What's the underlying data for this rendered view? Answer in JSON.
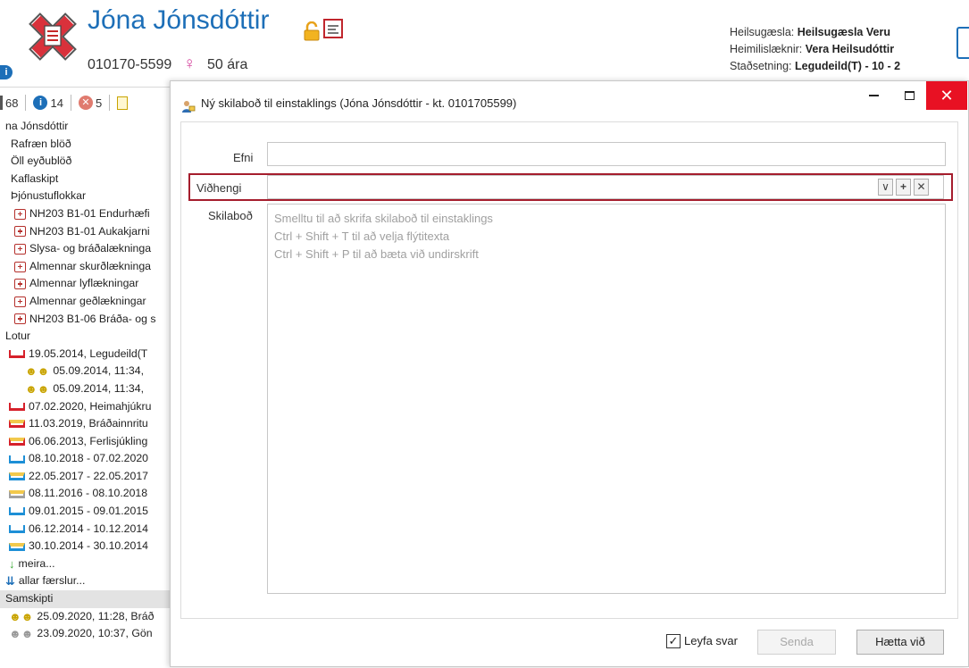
{
  "header": {
    "patient_name": "Jóna Jónsdóttir",
    "kennitala": "010170-5599",
    "age": "50 ára",
    "info_badge": "i",
    "clinic_label": "Heilsugæsla:",
    "clinic_value": "Heilsugæsla Veru",
    "doctor_label": "Heimilislæknir:",
    "doctor_value": "Vera Heilsudóttir",
    "location_label": "Staðsetning:",
    "location_value": "Legudeild(T) - 10 - 2"
  },
  "toolbar": {
    "count_1": "68",
    "count_info": "14",
    "info_glyph": "i",
    "count_alert": "5",
    "alert_glyph": "✕"
  },
  "tree": [
    {
      "label": "na Jónsdóttir",
      "icon": "none",
      "indent": 6
    },
    {
      "label": "Rafræn blöð",
      "icon": "none",
      "indent": 12
    },
    {
      "label": "Öll eyðublöð",
      "icon": "none",
      "indent": 12
    },
    {
      "label": "Kaflaskipt",
      "icon": "none",
      "indent": 12
    },
    {
      "label": "Þjónustuflokkar",
      "icon": "none",
      "indent": 12
    },
    {
      "label": "NH203 B1-01 Endurhæfi",
      "icon": "med",
      "indent": 16
    },
    {
      "label": "NH203 B1-01 Aukakjarni",
      "icon": "med",
      "indent": 16
    },
    {
      "label": "Slysa- og bráðalækninga",
      "icon": "med",
      "indent": 16
    },
    {
      "label": "Almennar skurðlækninga",
      "icon": "med",
      "indent": 16
    },
    {
      "label": "Almennar lyflækningar",
      "icon": "med",
      "indent": 16
    },
    {
      "label": "Almennar geðlækningar",
      "icon": "med",
      "indent": 16
    },
    {
      "label": "NH203 B1-06 Bráða- og s",
      "icon": "med",
      "indent": 16
    },
    {
      "label": "Lotur",
      "icon": "none",
      "indent": 6
    },
    {
      "label": "19.05.2014, Legudeild(T",
      "icon": "bed-red",
      "indent": 10
    },
    {
      "label": "05.09.2014, 11:34,",
      "icon": "people",
      "indent": 28
    },
    {
      "label": "05.09.2014, 11:34,",
      "icon": "people",
      "indent": 28
    },
    {
      "label": "07.02.2020, Heimahjúkru",
      "icon": "bed-red",
      "indent": 10
    },
    {
      "label": "11.03.2019, Bráðainnritu",
      "icon": "bed-redy",
      "indent": 10
    },
    {
      "label": "06.06.2013, Ferlisjúkling",
      "icon": "bed-redy",
      "indent": 10
    },
    {
      "label": "08.10.2018 - 07.02.2020",
      "icon": "bed-blue",
      "indent": 10
    },
    {
      "label": "22.05.2017 - 22.05.2017",
      "icon": "bed-bluey",
      "indent": 10
    },
    {
      "label": "08.11.2016 - 08.10.2018",
      "icon": "bed-grey",
      "indent": 10
    },
    {
      "label": "09.01.2015 - 09.01.2015",
      "icon": "bed-blue",
      "indent": 10
    },
    {
      "label": "06.12.2014 - 10.12.2014",
      "icon": "bed-blue",
      "indent": 10
    },
    {
      "label": "30.10.2014 - 30.10.2014",
      "icon": "bed-bluey",
      "indent": 10
    },
    {
      "label": "meira...",
      "icon": "arrow",
      "indent": 10
    },
    {
      "label": "allar færslur...",
      "icon": "darrow",
      "indent": 6
    },
    {
      "label": "Samskipti",
      "icon": "none",
      "indent": 6,
      "selected": true
    },
    {
      "label": "25.09.2020, 11:28, Bráð",
      "icon": "people",
      "indent": 10
    },
    {
      "label": "23.09.2020, 10:37, Gön",
      "icon": "people-grey",
      "indent": 10
    }
  ],
  "dialog": {
    "title": "Ný skilaboð til einstaklings (Jóna Jónsdóttir - kt. 0101705599)",
    "close_glyph": "✕",
    "efni_label": "Efni",
    "efni_value": "",
    "vidhengi_label": "Viðhengi",
    "vidhengi_value": "",
    "dropdown_glyph": "∨",
    "add_glyph": "+",
    "remove_glyph": "✕",
    "skilabod_label": "Skilaboð",
    "placeholder_lines": [
      "Smelltu til að skrifa skilaboð til einstaklings",
      "Ctrl + Shift + T til að velja flýtitexta",
      "Ctrl + Shift + P til að bæta við undirskrift"
    ],
    "allow_reply_label": "Leyfa svar",
    "allow_reply_checked": true,
    "check_glyph": "✓",
    "send_label": "Senda",
    "cancel_label": "Hætta við"
  },
  "colors": {
    "accent_blue": "#1d6fb8",
    "close_red": "#e81123",
    "highlight_border": "#a51d2d"
  }
}
